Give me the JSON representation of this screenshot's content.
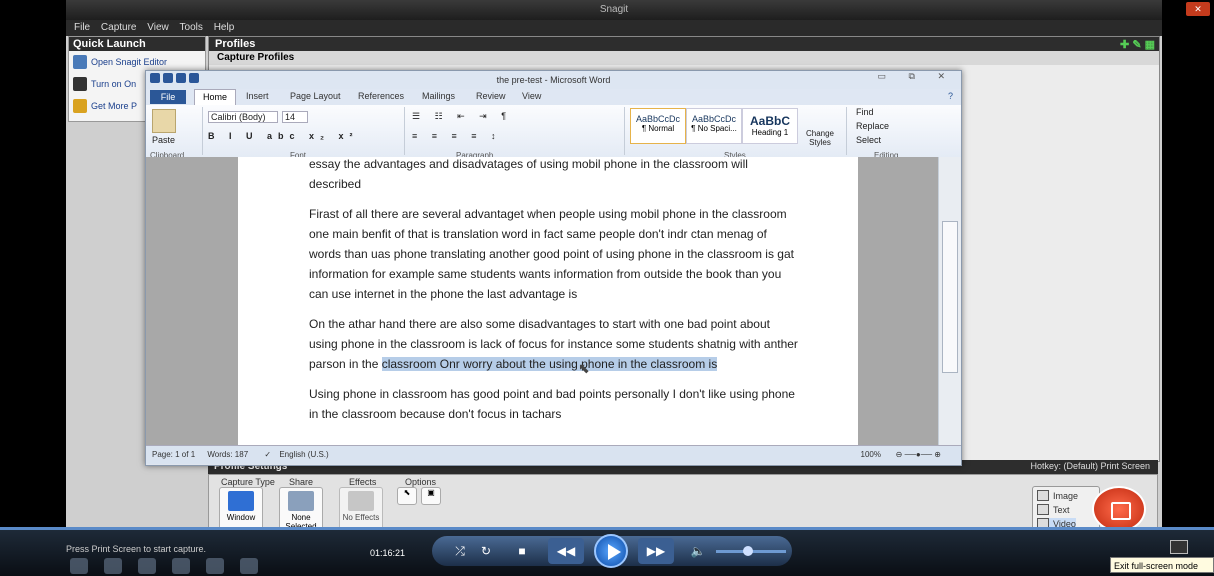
{
  "snagit": {
    "title": "Snagit",
    "menu": [
      "File",
      "Capture",
      "View",
      "Tools",
      "Help"
    ],
    "quick_launch": {
      "title": "Quick Launch",
      "items": [
        "Open Snagit Editor",
        "Turn on On",
        "Get More P"
      ]
    },
    "profiles": {
      "title": "Profiles",
      "subtitle": "Capture Profiles"
    },
    "profile_settings": {
      "title": "Profile Settings",
      "hotkey": "Hotkey: (Default) Print Screen"
    },
    "groups": {
      "capture_type": "Capture Type",
      "share": "Share",
      "effects": "Effects",
      "options": "Options"
    },
    "buttons": {
      "window": "Window",
      "none_selected": "None Selected",
      "no_effects": "No Effects"
    },
    "modes": [
      "Image",
      "Text",
      "Video"
    ]
  },
  "word": {
    "title": "the pre-test  -  Microsoft Word",
    "tabs": [
      "File",
      "Home",
      "Insert",
      "Page Layout",
      "References",
      "Mailings",
      "Review",
      "View"
    ],
    "ribbon": {
      "paste": "Paste",
      "font_name": "Calibri (Body)",
      "font_size": "14",
      "groups": [
        "Clipboard",
        "Font",
        "Paragraph",
        "Styles",
        "Editing"
      ],
      "styles": [
        {
          "preview": "AaBbCcDc",
          "name": "¶ Normal"
        },
        {
          "preview": "AaBbCcDc",
          "name": "¶ No Spaci..."
        },
        {
          "preview": "AaBbC",
          "name": "Heading 1"
        }
      ],
      "change_styles": "Change Styles",
      "editing": [
        "Find",
        "Replace",
        "Select"
      ]
    },
    "document": {
      "paragraphs": [
        "essay  the advantages and disadvatages of using mobil phone in the classroom will described",
        "Firast of all there are several advantaget  when people using mobil phone in the classroom  one main benfit of that  is translation word in fact same people don't indr  ctan  menag of  words  than uas phone translating  another good point of using phone in  the classroom  is gat information for example  same students wants  information from  outside the book than you can use internet in the phone the last advantage is",
        "On the athar hand there are also some disadvantages to start with one bad point about using phone in the classroom is lack of focus for instance some students shatnig with anther parson in the ",
        "Using phone in classroom has good point and bad points personally I don't like using  phone in the classroom because don't focus in tachars"
      ],
      "highlighted": "classroom Onr worry about the using phone in the classroom is"
    },
    "status": {
      "page": "Page: 1 of 1",
      "words": "Words: 187",
      "language": "English (U.S.)",
      "zoom": "100%"
    }
  },
  "player": {
    "press_note": "Press Print Screen to start capture.",
    "time": "01:16:21",
    "fullscreen_tip": "Exit full-screen mode",
    "volume_level": 0.45
  },
  "colors": {
    "accent": "#2b5797",
    "highlight": "#b6cde8",
    "capture": "#e04a2a"
  }
}
